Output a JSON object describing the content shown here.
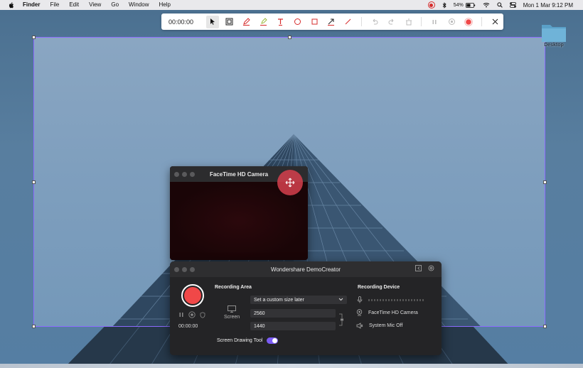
{
  "menubar": {
    "app": "Finder",
    "menus": [
      "File",
      "Edit",
      "View",
      "Go",
      "Window",
      "Help"
    ],
    "battery": "54%",
    "datetime": "Mon 1 Mar  9:12 PM"
  },
  "toolbar": {
    "time": "00:00:00",
    "tools": [
      "arrow-tool-icon",
      "frame-tool-icon",
      "pen-tool-icon",
      "highlighter-tool-icon",
      "text-tool-icon",
      "ellipse-tool-icon",
      "rectangle-tool-icon",
      "arrow-line-tool-icon",
      "line-tool-icon",
      "undo-icon",
      "redo-icon",
      "clear-icon",
      "pause-icon",
      "record-target-icon",
      "record-icon",
      "close-icon"
    ],
    "accent": "#d62b2b"
  },
  "desktop": {
    "folder_label": "Desktop"
  },
  "selection": {
    "border_color": "#8c6bff"
  },
  "camera": {
    "title": "FaceTime HD Camera"
  },
  "democreator": {
    "title": "Wondershare DemoCreator",
    "timer": "00:00:00",
    "recording_area_label": "Recording Area",
    "screen_label": "Screen",
    "size_option": "Set a custom size later",
    "width": "2560",
    "height": "1440",
    "recording_device_label": "Recording Device",
    "camera_device": "FaceTime HD Camera",
    "mic_device": "System Mic Off",
    "drawing_tool_label": "Screen Drawing Tool",
    "drawing_tool_on": true,
    "toggle_color": "#7b5cf5",
    "record_color": "#f04848"
  }
}
